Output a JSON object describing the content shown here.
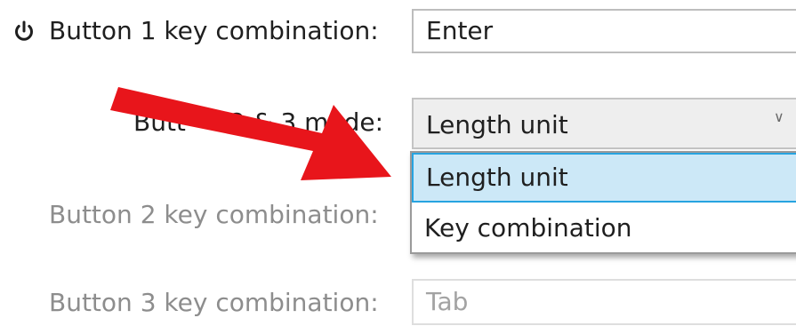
{
  "button1": {
    "label": "Button 1 key combination:",
    "value": "Enter"
  },
  "mode": {
    "label_left": "Butt",
    "label_right": "2 & 3 mode:",
    "selected_value": "Length unit",
    "options": [
      "Length unit",
      "Key combination"
    ]
  },
  "button2": {
    "label": "Button 2 key combination:"
  },
  "button3": {
    "label": "Button 3 key combination:",
    "value": "Tab"
  },
  "icons": {
    "power": "power-icon",
    "dropdown": "chevron-down-icon",
    "annotation": "red-arrow-icon"
  },
  "colors": {
    "arrow": "#e8151b",
    "selection_fill": "#cce8f7",
    "selection_border": "#27a3e0",
    "disabled_text": "#8d8d8d"
  }
}
